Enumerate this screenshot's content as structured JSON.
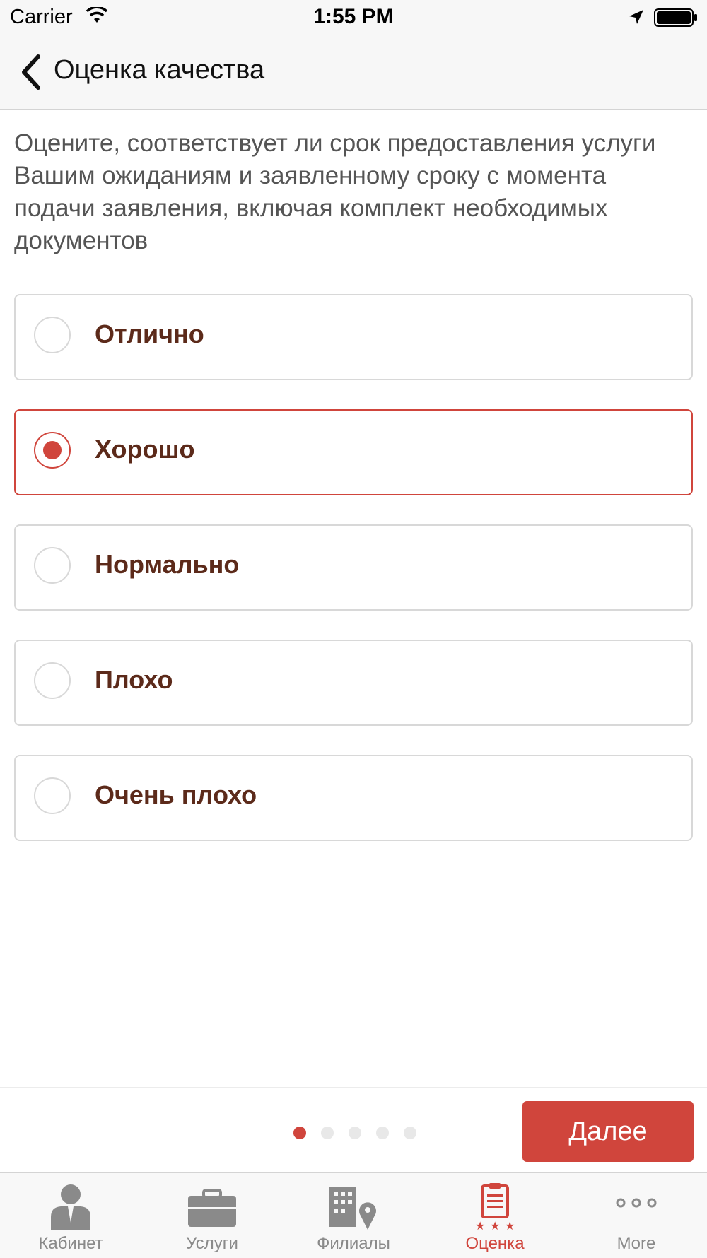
{
  "status_bar": {
    "carrier": "Carrier",
    "time": "1:55 PM",
    "icons": [
      "wifi-icon",
      "location-arrow-icon",
      "battery-icon"
    ]
  },
  "nav": {
    "back_icon": "chevron-left-icon",
    "title": "Оценка качества"
  },
  "question": "Оцените, соответствует ли срок предоставления услуги Вашим ожиданиям и заявленному сроку с момента подачи заявления, включая комплект необходимых документов",
  "options": [
    {
      "label": "Отлично",
      "selected": false
    },
    {
      "label": "Хорошо",
      "selected": true
    },
    {
      "label": "Нормально",
      "selected": false
    },
    {
      "label": "Плохо",
      "selected": false
    },
    {
      "label": "Очень плохо",
      "selected": false
    }
  ],
  "pager": {
    "total": 5,
    "current": 1
  },
  "next_button": "Далее",
  "tabs": [
    {
      "label": "Кабинет",
      "icon": "person-icon",
      "active": false
    },
    {
      "label": "Услуги",
      "icon": "briefcase-icon",
      "active": false
    },
    {
      "label": "Филиалы",
      "icon": "building-location-icon",
      "active": false
    },
    {
      "label": "Оценка",
      "icon": "clipboard-stars-icon",
      "active": true
    },
    {
      "label": "More",
      "icon": "more-dots-icon",
      "active": false
    }
  ],
  "colors": {
    "accent": "#d0453c",
    "option_text": "#5c2a1a",
    "inactive_tab": "#8a8a8a"
  }
}
